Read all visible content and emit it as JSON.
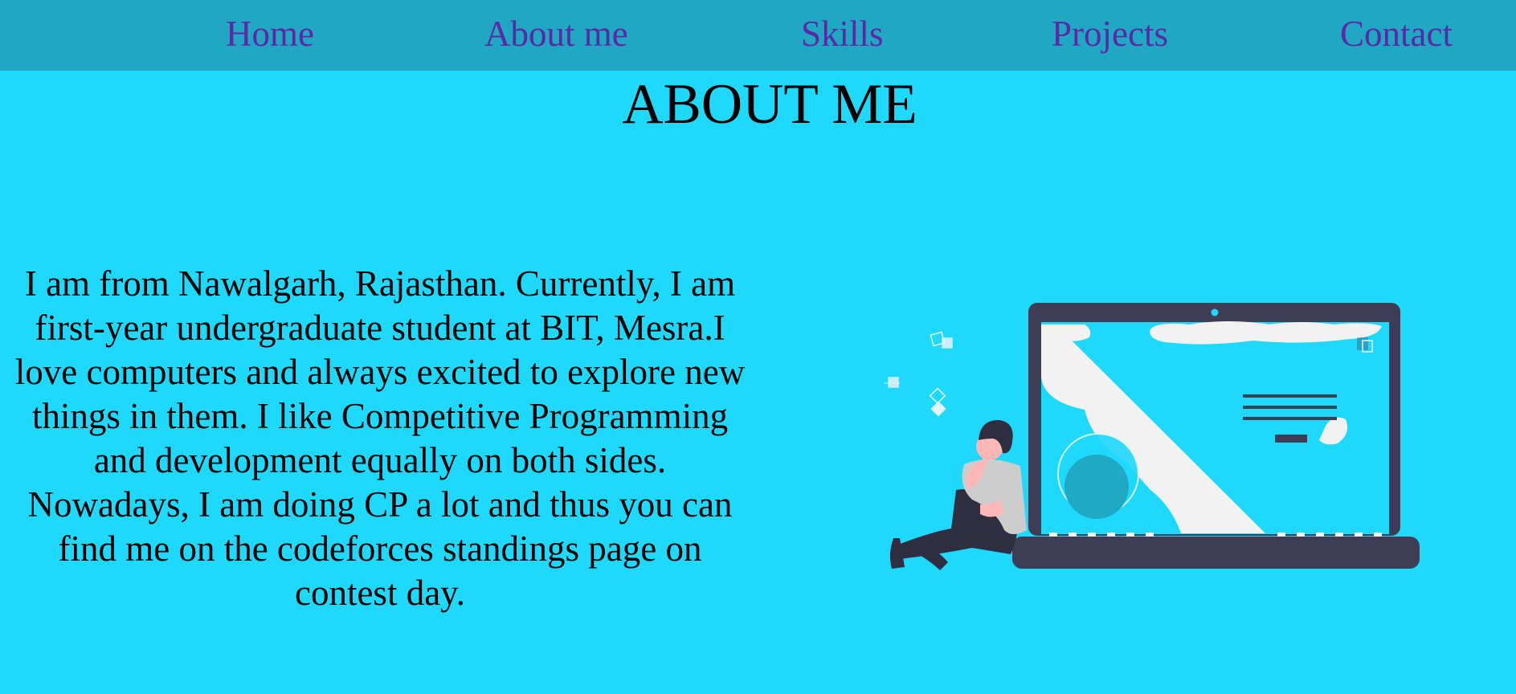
{
  "nav": {
    "items": [
      {
        "label": "Home"
      },
      {
        "label": "About me"
      },
      {
        "label": "Skills"
      },
      {
        "label": "Projects"
      },
      {
        "label": "Contact"
      }
    ]
  },
  "about": {
    "title": "ABOUT ME",
    "bio": "I am from Nawalgarh, Rajasthan. Currently, I am first-year undergraduate student at BIT, Mesra.I love computers and always excited to explore new things in them. I like Competitive Programming and development equally on both sides. Nowadays, I am doing CP a lot and thus you can find me on the codeforces standings page on contest day."
  },
  "colors": {
    "page_background": "#1fd9fd",
    "navbar_background": "#20a7c4",
    "nav_link": "#5a2aa5",
    "laptop_frame": "#3f3d56",
    "person_skin": "#ffb8b8",
    "person_shirt": "#cccccc"
  },
  "illustration": {
    "icon": "person-with-laptop-illustration"
  }
}
